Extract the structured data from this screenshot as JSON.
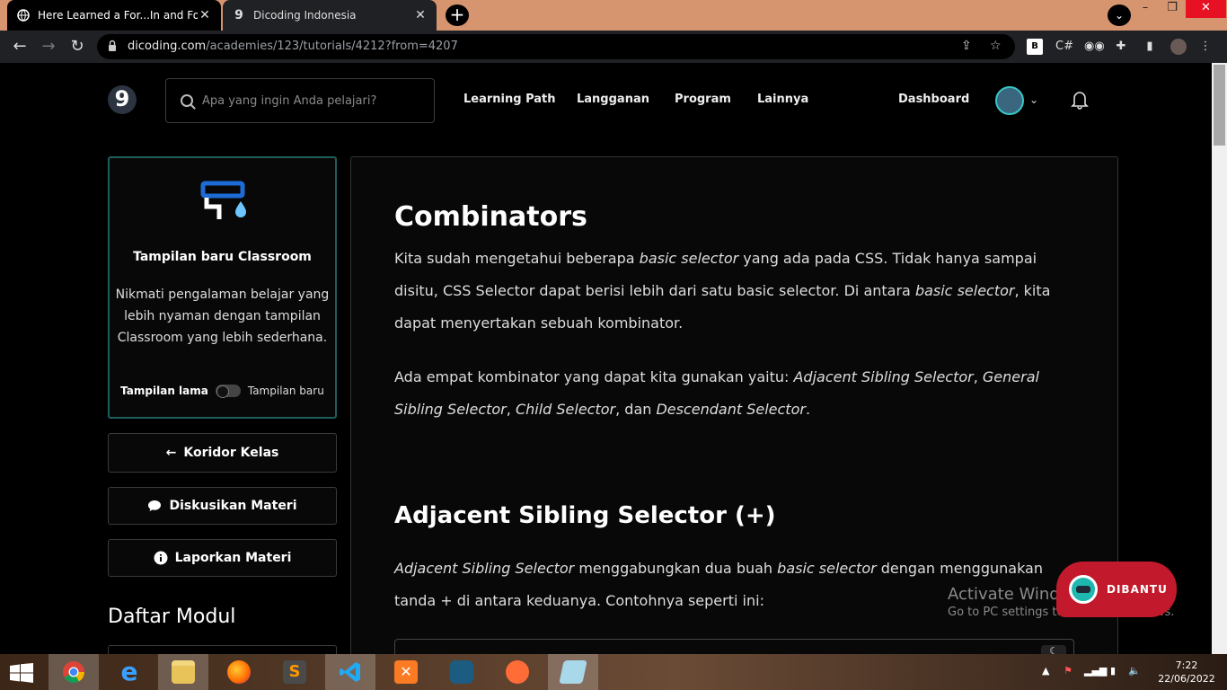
{
  "browser": {
    "tabs": [
      {
        "title": "Here Learned a For...In and For...o"
      },
      {
        "title": "Dicoding Indonesia"
      }
    ],
    "url_host": "dicoding.com",
    "url_path": "/academies/123/tutorials/4212?from=4207"
  },
  "header": {
    "logo_glyph": "9",
    "search_placeholder": "Apa yang ingin Anda pelajari?",
    "nav": [
      "Learning Path",
      "Langganan",
      "Program",
      "Lainnya"
    ],
    "dashboard": "Dashboard"
  },
  "sidebar": {
    "promo_title": "Tampilan baru Classroom",
    "promo_desc": "Nikmati pengalaman belajar yang lebih nyaman dengan tampilan Classroom yang lebih sederhana.",
    "toggle_old": "Tampilan lama",
    "toggle_new": "Tampilan baru",
    "buttons": [
      "Koridor Kelas",
      "Diskusikan Materi",
      "Laporkan Materi"
    ],
    "modules_heading": "Daftar Modul"
  },
  "content": {
    "heading1": "Combinators",
    "heading2": "Adjacent Sibling Selector (+)",
    "p1": [
      {
        "t": "Kita sudah mengetahui beberapa ",
        "i": false
      },
      {
        "t": "basic selector",
        "i": true
      },
      {
        "t": " yang ada pada CSS. Tidak hanya sampai disitu, CSS Selector dapat berisi lebih dari satu basic selector. Di antara ",
        "i": false
      },
      {
        "t": "basic selector",
        "i": true
      },
      {
        "t": ", kita dapat menyertakan sebuah kombinator.",
        "i": false
      }
    ],
    "p2": [
      {
        "t": "Ada empat kombinator yang dapat kita gunakan yaitu: ",
        "i": false
      },
      {
        "t": "Adjacent Sibling Selector",
        "i": true
      },
      {
        "t": ", ",
        "i": false
      },
      {
        "t": "General Sibling Selector",
        "i": true
      },
      {
        "t": ", ",
        "i": false
      },
      {
        "t": "Child Selector",
        "i": true
      },
      {
        "t": ", dan ",
        "i": false
      },
      {
        "t": "Descendant Selector",
        "i": true
      },
      {
        "t": ".",
        "i": false
      }
    ],
    "p3": [
      {
        "t": "Adjacent Sibling Selector",
        "i": true
      },
      {
        "t": " menggabungkan dua buah ",
        "i": false
      },
      {
        "t": "basic selector",
        "i": true
      },
      {
        "t": " dengan menggunakan tanda + di antara keduanya. Contohnya seperti ini:",
        "i": false
      }
    ]
  },
  "help_button": "DIBANTU",
  "watermark": {
    "title": "Activate Windows",
    "sub": "Go to PC settings to activate Windows."
  },
  "clock": {
    "time": "7:22",
    "date": "22/06/2022"
  },
  "colors": {
    "tabbar": "#d6946f",
    "help": "#c21a2c",
    "promo_border": "#1f5c5c"
  }
}
